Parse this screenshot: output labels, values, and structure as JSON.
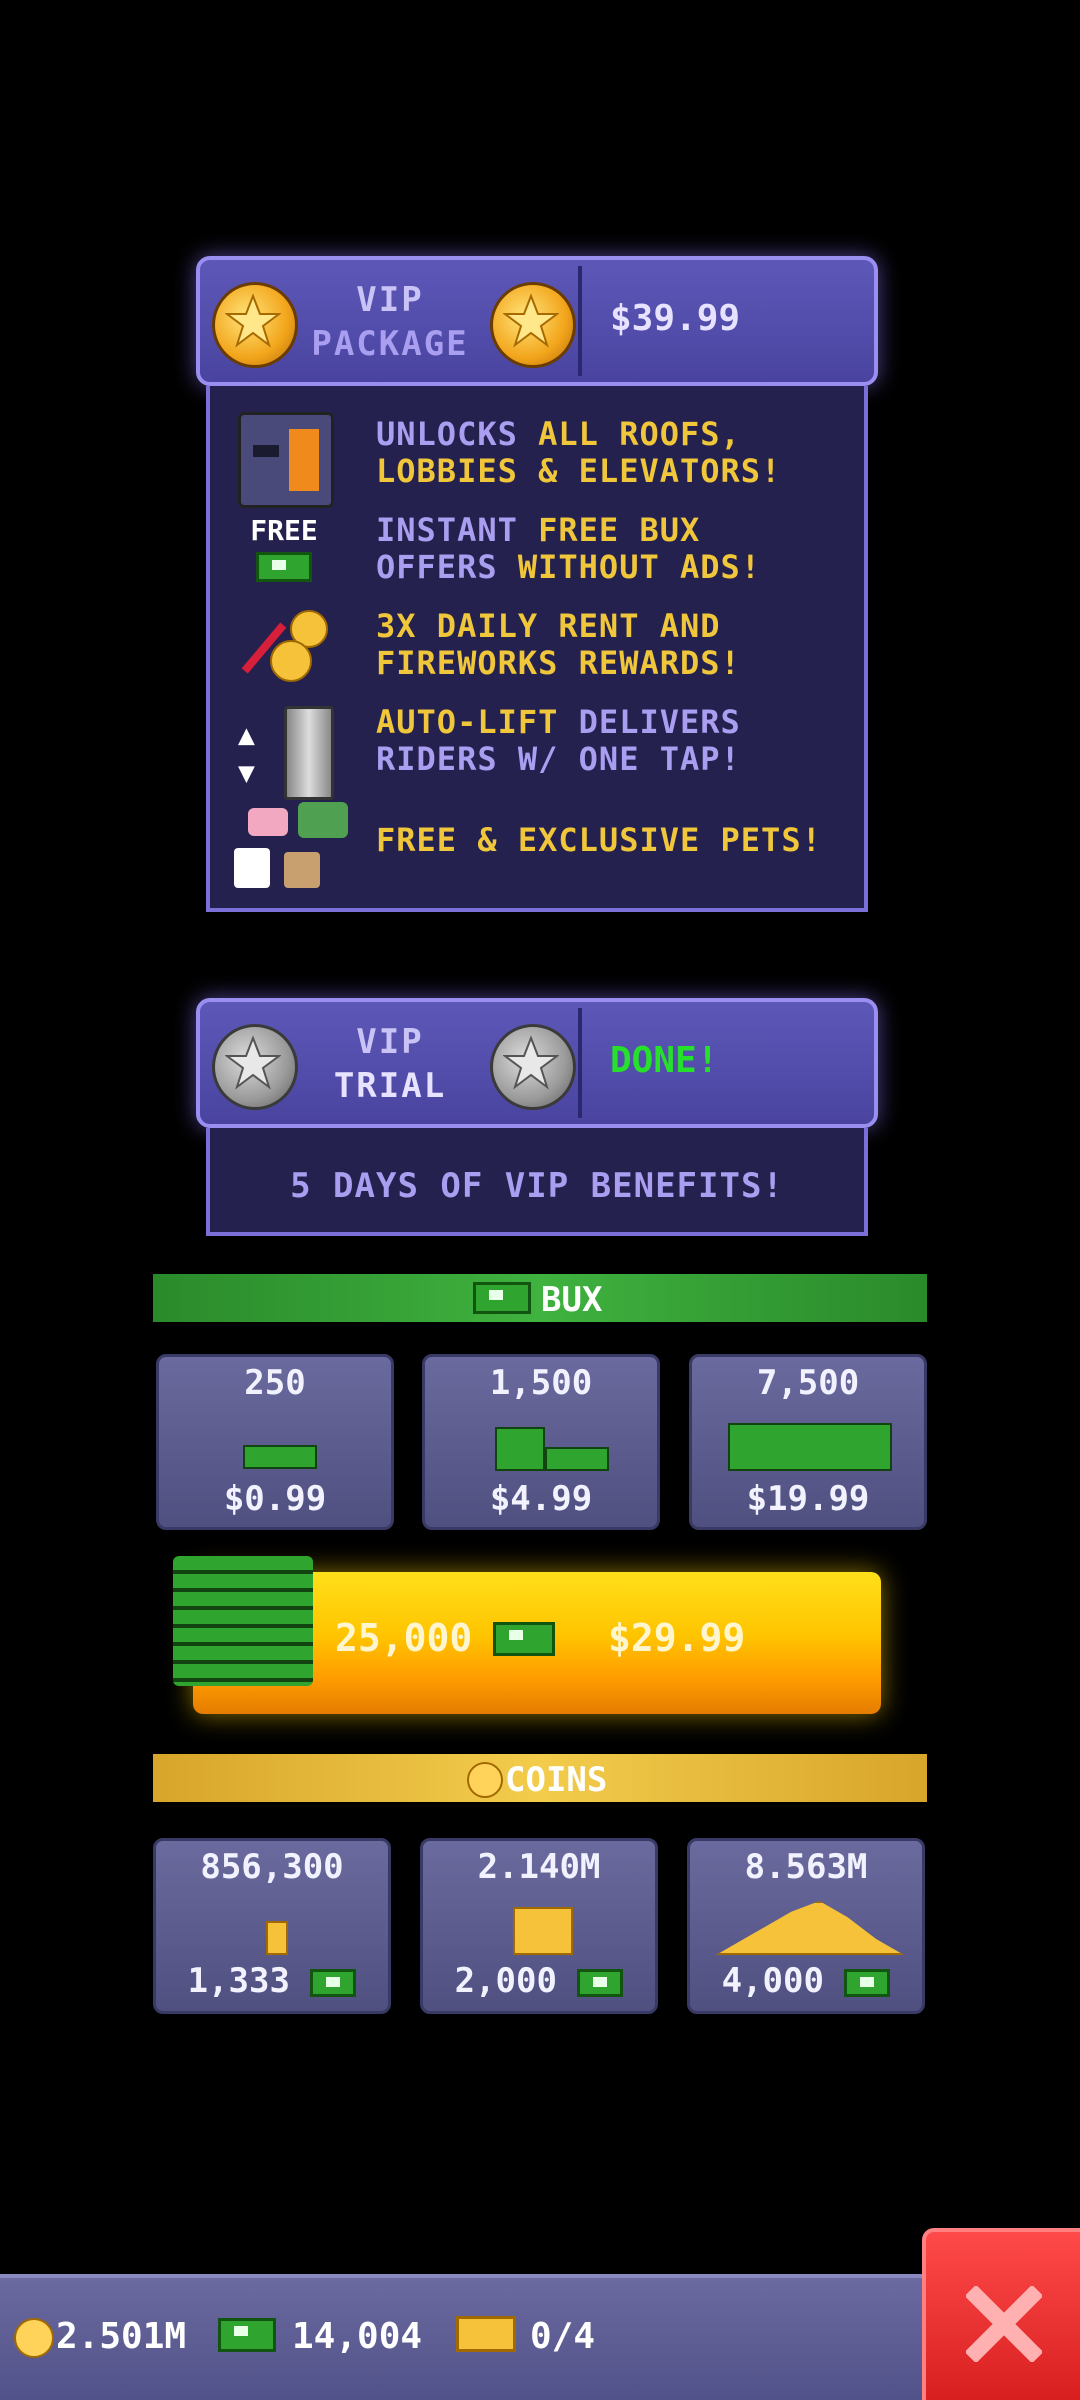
{
  "vip_package": {
    "title_line1": "VIP",
    "title_line2": "PACKAGE",
    "price": "$39.99",
    "features": [
      {
        "line1_a": "UNLOCKS ",
        "line1_b": "ALL ROOFS,",
        "line2": "LOBBIES & ELEVATORS!",
        "icon": "robot-cat-icon"
      },
      {
        "line1_a": "INSTANT ",
        "line1_b": "FREE BUX",
        "line2_a": "OFFERS ",
        "line2_b": "WITHOUT ADS!",
        "badge": "FREE",
        "icon": "free-bux-icon"
      },
      {
        "line1": "3X DAILY RENT AND",
        "line2": "FIREWORKS REWARDS!",
        "icon": "firework-coins-icon"
      },
      {
        "line1_a": "AUTO-LIFT ",
        "line1_b": "DELIVERS",
        "line2": "RIDERS W/ ONE TAP!",
        "icon": "elevator-icon"
      },
      {
        "line1": "FREE & EXCLUSIVE PETS!",
        "icon": "pets-icon"
      }
    ]
  },
  "vip_trial": {
    "title_line1": "VIP",
    "title_line2": "TRIAL",
    "status": "DONE!",
    "benefit": "5 DAYS OF VIP BENEFITS!"
  },
  "bux_section": {
    "label": "BUX",
    "packs": [
      {
        "amount": "250",
        "price": "$0.99"
      },
      {
        "amount": "1,500",
        "price": "$4.99"
      },
      {
        "amount": "7,500",
        "price": "$19.99"
      }
    ],
    "featured": {
      "amount": "25,000",
      "price": "$29.99"
    }
  },
  "coins_section": {
    "label": "COINS",
    "packs": [
      {
        "amount": "856,300",
        "cost": "1,333"
      },
      {
        "amount": "2.140M",
        "cost": "2,000"
      },
      {
        "amount": "8.563M",
        "cost": "4,000"
      }
    ]
  },
  "status_bar": {
    "coins": "2.501M",
    "bux": "14,004",
    "tickets": "0/4"
  },
  "colors": {
    "vip_panel": "#5d57b8",
    "accent_yellow": "#f0c63a",
    "accent_purple": "#a99ef0",
    "done_green": "#27e02c",
    "close_red": "#e02a2a"
  }
}
